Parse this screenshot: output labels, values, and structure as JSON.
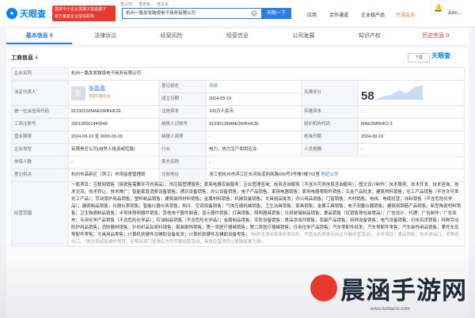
{
  "header": {
    "logo_text": "天眼查",
    "promo_line1": "国家中小企业发展子基金旗下",
    "promo_line2": "官方备案企业征信机构",
    "cert_items": [
      "查公司",
      "查老板",
      "查关系"
    ],
    "search_value": "杭州一路发发跨境电子商务有限公司",
    "search_button": "天眼一下",
    "nav": [
      "应用",
      "合作通道",
      "企业级产品",
      "开通会员",
      "Ashi..."
    ]
  },
  "tabs": [
    {
      "label": "基本信息",
      "count": "9"
    },
    {
      "label": "法律诉讼"
    },
    {
      "label": "经营风险"
    },
    {
      "label": "经营信息"
    },
    {
      "label": "公司发展"
    },
    {
      "label": "知识产权"
    },
    {
      "label": "历史信息",
      "count": "0"
    }
  ],
  "section": {
    "title": "工商信息",
    "count": "4",
    "qr_label": "下载",
    "watermark": "天眼查"
  },
  "info": {
    "company_name_label": "企业名称",
    "company_name": "杭州一路发发跨境电子商务有限公司",
    "legal_rep_label": "法定代表人",
    "legal_rep_avatar": "张",
    "legal_rep_name": "张晶晶",
    "legal_rep_sub": "任职1家企业",
    "reg_status_label": "登记状态",
    "reg_status": "存续",
    "est_date_label": "成立日期",
    "est_date": "2024-09-19",
    "score_label": "天眼评分",
    "score": "58",
    "credit_code_label": "统一社会信用代码",
    "credit_code": "91330108MAE0WRHK2E",
    "reg_capital_label": "注册资本",
    "reg_capital": "100万人民币",
    "paid_capital_label": "实缴资本",
    "paid_capital": "-",
    "reg_no_label": "工商注册号",
    "reg_no": "330108001440648",
    "taxpayer_id_label": "纳税人识别号",
    "taxpayer_id": "91330108MAE0WRHK2E",
    "org_code_label": "组织机构代码",
    "org_code": "MAE0WRHK2-2",
    "term_label": "营业期限",
    "term": "2024-09-19 至 9999-09-09",
    "taxpayer_qual_label": "纳税人资质",
    "taxpayer_qual": "-",
    "approval_date_label": "核准日期",
    "approval_date": "2024-09-19",
    "type_label": "企业类型",
    "type": "有限责任公司(自然人投资或控股)",
    "industry_label": "行业",
    "industry": "电力、热力生产和供应业",
    "staff_size_label": "人员规模",
    "staff_size": "-",
    "insured_label": "参保人数",
    "insured": "-",
    "english_name_label": "英文名称",
    "english_name": "-",
    "authority_label": "登记机关",
    "authority": "杭州市高新区（滨江）市场监督管理局",
    "address_label": "注册地址",
    "address": "浙江省杭州市滨江区长河街道网商路699号3号楼7楼702室",
    "address_link": "附近公司",
    "scope_label": "经营范围",
    "scope": "一般项目：互联网销售（除销售需要许可的商品）；供应链管理服务；家用电器安装服务；企业管理咨询；信息咨询服务（不含许可类信息咨询服务）；图文设计制作；技术服务、技术开发、技术咨询、技术交流、技术转让、技术推广；智能家庭消费设备销售；通讯设备销售；办公设备销售；电子产品销售；家用电器销售；家用电器零配件销售；五金产品批发；建筑材料销售；化工产品销售（不含许可类化工产品）；劳动保护用品销售；塑料制品销售；建筑装饰材料销售；金属材料销售；机械设备销售；文具用品批发；办公用品销售；门窗销售；木材销售；电线、电缆经营；涂料销售（不含危险化学品）；搪瓷制品销售；仪器仪表销售；智能仪器仪表销售；制冷、空调设备销售；气体压缩机械销售；卫生洁具销售；家具销售；金属工具销售；电子测量仪器销售；建筑用钢筋产品销售；新型陶瓷材料销售；卫生陶瓷制品销售；半导体照明器件销售；其他电子器件制造；显示器件销售；灯具销售；照明器具销售；日用玻璃制品销售；食品销售（仅销售预包装食品）；广告设计、代理；广告制作；广告发布；专用化学产品销售（不含危险化学品）；石油制品销售（不含危险化学品）；金属制品销售；安防设备销售；食品添加剂销售；农副产品销售；特种设备销售；电气设备销售；日用百货销售；特种劳动防护用品销售；消防器材销售；针纺织品及原料销售；服装服饰零售；第一类医疗器械销售；第二类医疗器械销售；日用化学产品销售；汽车零配件批发；汽车零配件零售；汽车装饰用品销售；摩托车及零配件零售；文具用品零售；计算机软硬件及辅助设备批发；计算机软硬件及辅助设备零售；",
    "scope_faded": "（除依法须经批准的项目外，凭营业执照依法自主开展经营活动）。许可项目：食品销售；技术进出口；货物进出口。（依法须经批准的项目，经相关部门批准后方可开展经营活动，具体经营项目以审批结果为准）。"
  },
  "site_watermark": {
    "text": "晨涵手游网",
    "url": "www.liuhiacre.com"
  }
}
